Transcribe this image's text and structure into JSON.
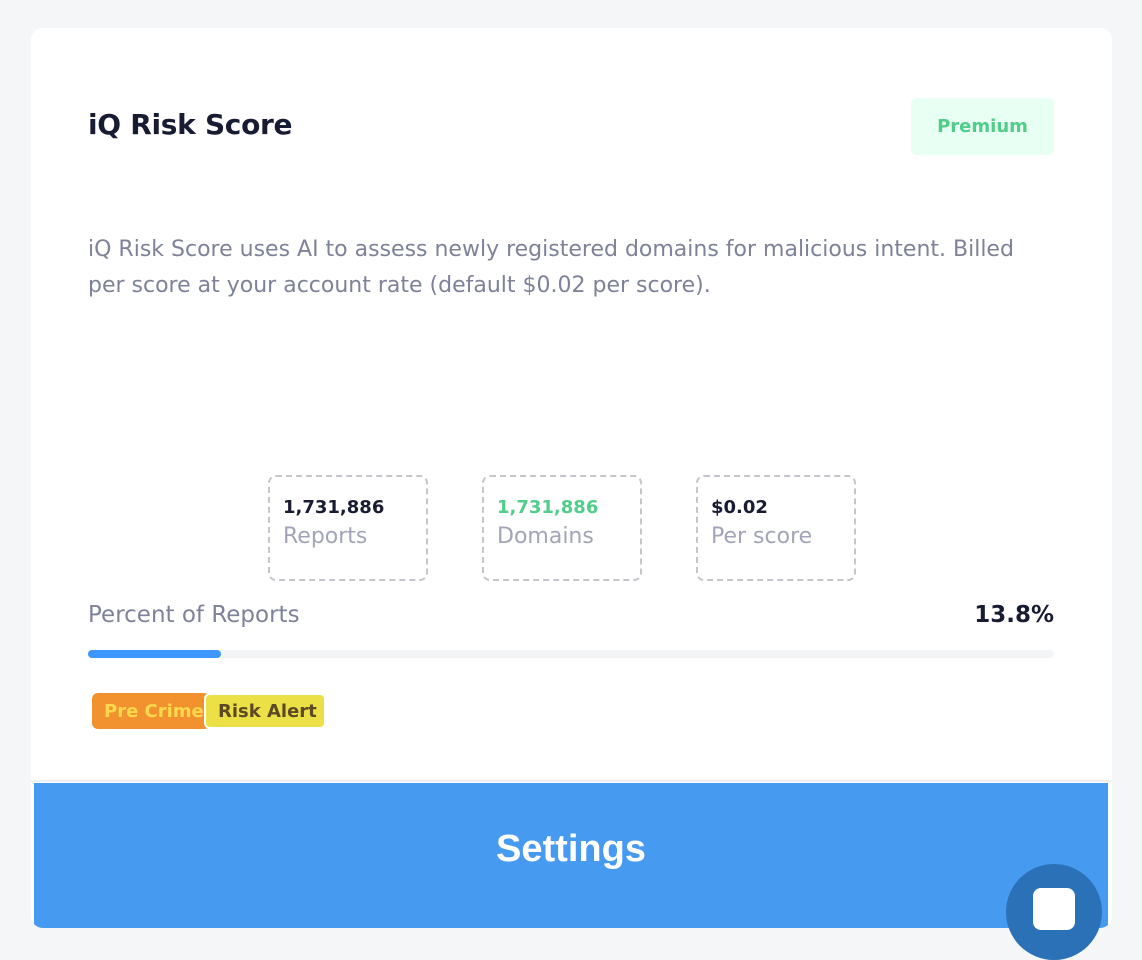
{
  "card": {
    "title": "iQ Risk Score",
    "badge": "Premium",
    "description": "iQ Risk Score uses AI to assess newly registered domains for malicious intent. Billed per score at your account rate (default $0.02 per score)."
  },
  "stats": [
    {
      "value": "1,731,886",
      "label": "Reports"
    },
    {
      "value": "1,731,886",
      "label": "Domains"
    },
    {
      "value": "$0.02",
      "label": "Per score"
    }
  ],
  "progress": {
    "label": "Percent of Reports",
    "value_text": "13.8%",
    "percent": 13.8
  },
  "tags": [
    {
      "label": "Pre Crime"
    },
    {
      "label": "Risk Alert"
    }
  ],
  "settings_label": "Settings",
  "chat": {
    "icon": "chat-icon"
  },
  "colors": {
    "accent": "#469af0",
    "progress": "#3e97ff",
    "premium_bg": "#e8fff3",
    "premium_text": "#50cd89",
    "domains_value": "#50cd89",
    "tag_precrime_bg": "#f1922e",
    "tag_risk_bg": "#ebe046"
  }
}
